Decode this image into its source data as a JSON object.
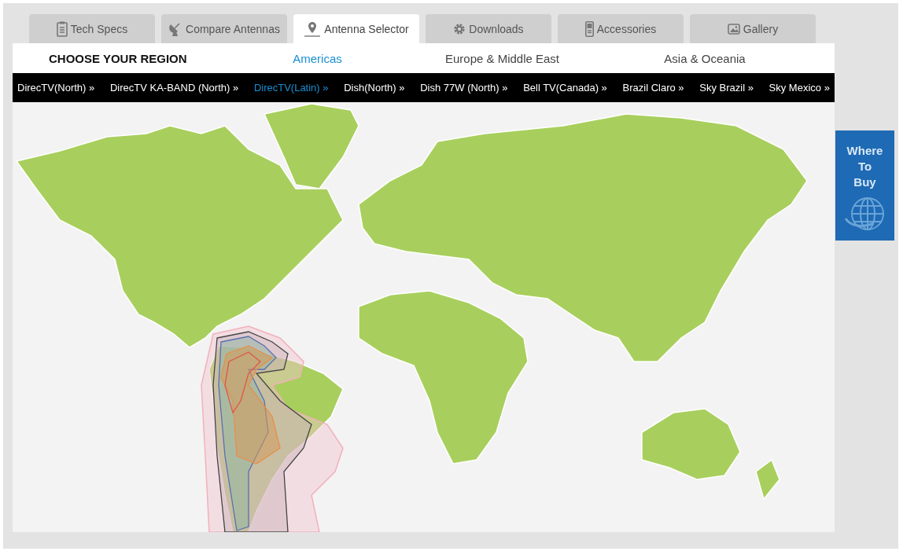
{
  "tabs": [
    {
      "label": "Tech Specs",
      "selected": false
    },
    {
      "label": "Compare Antennas",
      "selected": false
    },
    {
      "label": "Antenna Selector",
      "selected": true
    },
    {
      "label": "Downloads",
      "selected": false
    },
    {
      "label": "Accessories",
      "selected": false
    },
    {
      "label": "Gallery",
      "selected": false
    }
  ],
  "region_heading": "CHOOSE YOUR REGION",
  "regions": [
    {
      "label": "Americas",
      "selected": true
    },
    {
      "label": "Europe & Middle East",
      "selected": false
    },
    {
      "label": "Asia & Oceania",
      "selected": false
    }
  ],
  "services": [
    {
      "label": "DirecTV(North) »",
      "selected": false
    },
    {
      "label": "DirecTV KA-BAND (North) »",
      "selected": false
    },
    {
      "label": "DirecTV(Latin) »",
      "selected": true
    },
    {
      "label": "Dish(North) »",
      "selected": false
    },
    {
      "label": "Dish 77W (North) »",
      "selected": false
    },
    {
      "label": "Bell TV(Canada) »",
      "selected": false
    },
    {
      "label": "Brazil Claro »",
      "selected": false
    },
    {
      "label": "Sky Brazil »",
      "selected": false
    },
    {
      "label": "Sky Mexico »",
      "selected": false
    }
  ],
  "where_to_buy": "Where To Buy"
}
